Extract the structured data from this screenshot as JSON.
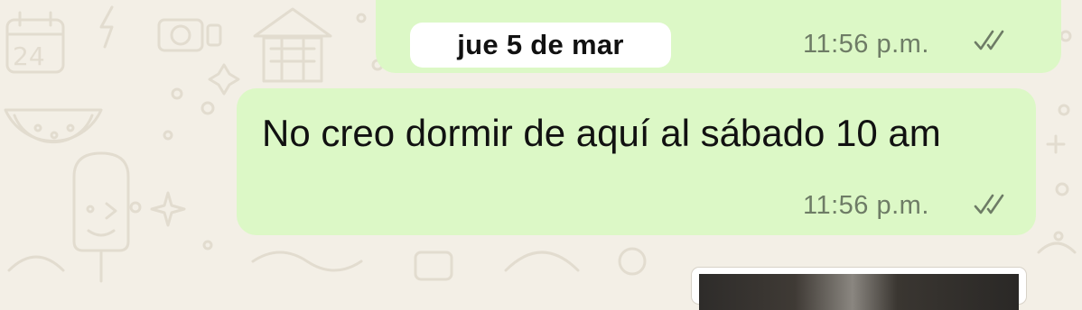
{
  "chat": {
    "date_separator": "jue 5 de mar",
    "previous_message": {
      "time": "11:56 p.m.",
      "status_icon": "double-check-icon"
    },
    "message": {
      "text": "No creo dormir de aquí al sábado 10 am",
      "time": "11:56 p.m.",
      "status_icon": "double-check-icon"
    },
    "next_message": {
      "type": "image",
      "icon": "image-thumbnail"
    }
  },
  "colors": {
    "wallpaper": "#f3efe6",
    "doodle": "#e2dccf",
    "outgoing_bubble": "#dcf8c6",
    "date_chip": "#ffffff",
    "meta_text": "#6e7c66"
  }
}
